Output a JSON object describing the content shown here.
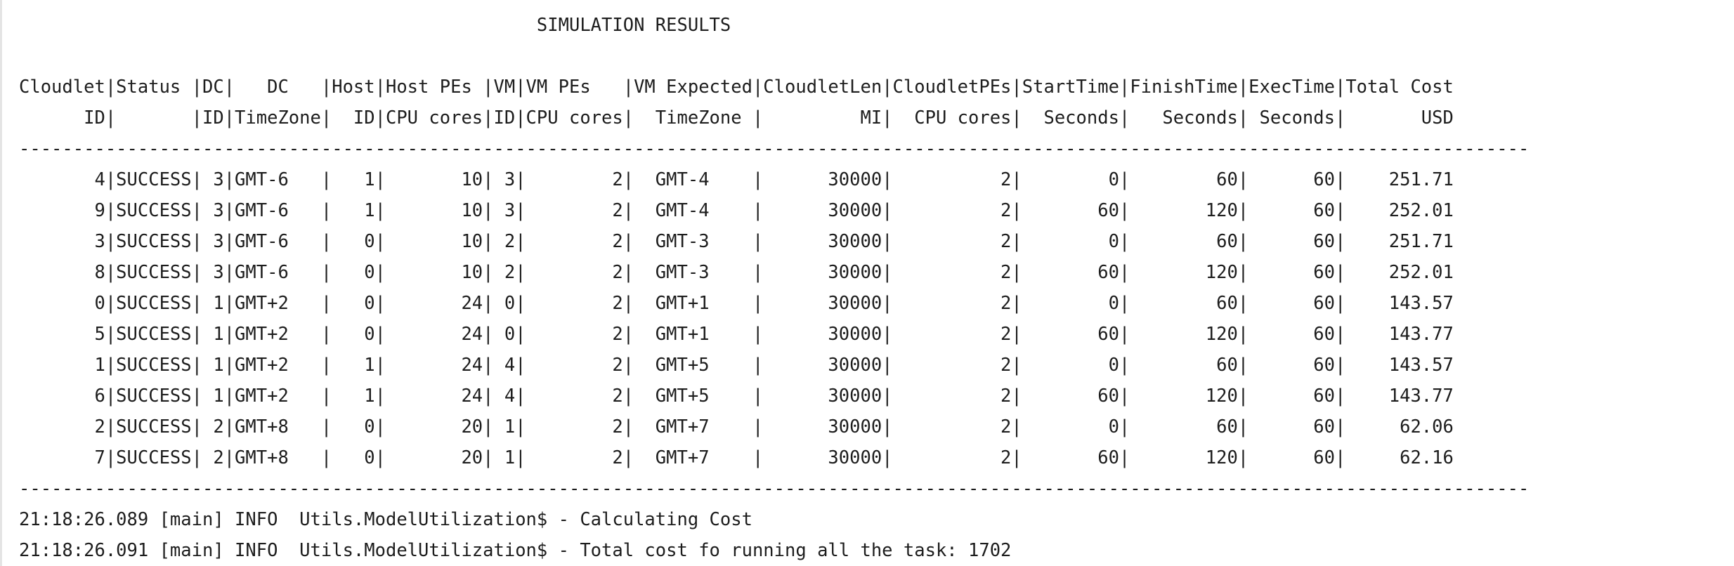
{
  "console": {
    "title": "                                                SIMULATION RESULTS",
    "header_line_1": "Cloudlet|Status |DC|   DC   |Host|Host PEs |VM|VM PEs   |VM Expected|CloudletLen|CloudletPEs|StartTime|FinishTime|ExecTime|Total Cost",
    "header_line_2": "      ID|       |ID|TimeZone|  ID|CPU cores|ID|CPU cores|  TimeZone |         MI|  CPU cores|  Seconds|   Seconds| Seconds|       USD",
    "separator": "--------------------------------------------------------------------------------------------------------------------------------------------",
    "rows": [
      "       4|SUCCESS| 3|GMT-6   |   1|       10| 3|        2|  GMT-4    |      30000|          2|        0|        60|      60|    251.71",
      "       9|SUCCESS| 3|GMT-6   |   1|       10| 3|        2|  GMT-4    |      30000|          2|       60|       120|      60|    252.01",
      "       3|SUCCESS| 3|GMT-6   |   0|       10| 2|        2|  GMT-3    |      30000|          2|        0|        60|      60|    251.71",
      "       8|SUCCESS| 3|GMT-6   |   0|       10| 2|        2|  GMT-3    |      30000|          2|       60|       120|      60|    252.01",
      "       0|SUCCESS| 1|GMT+2   |   0|       24| 0|        2|  GMT+1    |      30000|          2|        0|        60|      60|    143.57",
      "       5|SUCCESS| 1|GMT+2   |   0|       24| 0|        2|  GMT+1    |      30000|          2|       60|       120|      60|    143.77",
      "       1|SUCCESS| 1|GMT+2   |   1|       24| 4|        2|  GMT+5    |      30000|          2|        0|        60|      60|    143.57",
      "       6|SUCCESS| 1|GMT+2   |   1|       24| 4|        2|  GMT+5    |      30000|          2|       60|       120|      60|    143.77",
      "       2|SUCCESS| 2|GMT+8   |   0|       20| 1|        2|  GMT+7    |      30000|          2|        0|        60|      60|     62.06",
      "       7|SUCCESS| 2|GMT+8   |   0|       20| 1|        2|  GMT+7    |      30000|          2|       60|       120|      60|     62.16"
    ],
    "log_1": "21:18:26.089 [main] INFO  Utils.ModelUtilization$ - Calculating Cost",
    "log_2": "21:18:26.091 [main] INFO  Utils.ModelUtilization$ - Total cost fo running all the task: 1702"
  }
}
